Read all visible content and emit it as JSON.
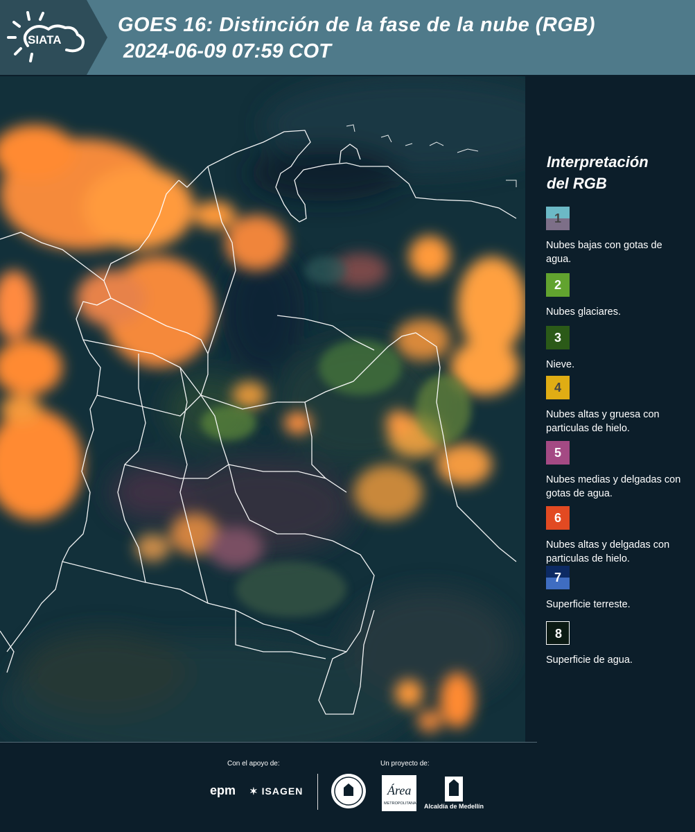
{
  "header": {
    "logo_text": "SIATA",
    "title": "GOES 16: Distinción de la fase de la nube (RGB)",
    "datetime": "2024-06-09 07:59 COT"
  },
  "legend": {
    "title_line1": "Interpretación",
    "title_line2": "del RGB",
    "items": [
      {
        "number": "1",
        "label": "Nubes bajas con gotas de agua.",
        "color_top": "#6cb9c6",
        "color_bottom": "#7d6f88",
        "number_color": "#444444"
      },
      {
        "number": "2",
        "label": "Nubes glaciares.",
        "color_top": "#62a32f",
        "color_bottom": "#62a32f",
        "number_color": "#ffffff"
      },
      {
        "number": "3",
        "label": "Nieve.",
        "color_top": "#2b5a18",
        "color_bottom": "#2b5a18",
        "number_color": "#ffffff"
      },
      {
        "number": "4",
        "label": "Nubes altas y gruesa con particulas de hielo.",
        "color_top": "#e0ad14",
        "color_bottom": "#e0ad14",
        "number_color": "#444444"
      },
      {
        "number": "5",
        "label": "Nubes medias y delgadas con gotas de agua.",
        "color_top": "#a44a84",
        "color_bottom": "#a44a84",
        "number_color": "#ffffff"
      },
      {
        "number": "6",
        "label": "Nubes altas y delgadas con particulas de hielo.",
        "color_top": "#e24a22",
        "color_bottom": "#e24a22",
        "number_color": "#ffffff"
      },
      {
        "number": "7",
        "label": "Superficie terreste.",
        "color_top": "#0c2a63",
        "color_bottom": "#3f6dc1",
        "number_color": "#ffffff"
      },
      {
        "number": "8",
        "label": "Superficie de agua.",
        "color_top": "#0b1a14",
        "color_bottom": "#0b1a14",
        "number_color": "#ffffff"
      }
    ]
  },
  "footer": {
    "support_label": "Con el apoyo de:",
    "project_label": "Un proyecto de:",
    "sponsor_epm": "epm",
    "sponsor_isagen": "ISAGEN",
    "partner_area": "Área Metropolitana Valle de Aburrá",
    "partner_alcaldia": "Alcaldía de Medellín"
  },
  "colors": {
    "header_bg": "#4f7a8a",
    "page_bg": "#0c1e2a",
    "cloud_orange": "#ff8a2e",
    "surface_dark": "#13303c"
  }
}
